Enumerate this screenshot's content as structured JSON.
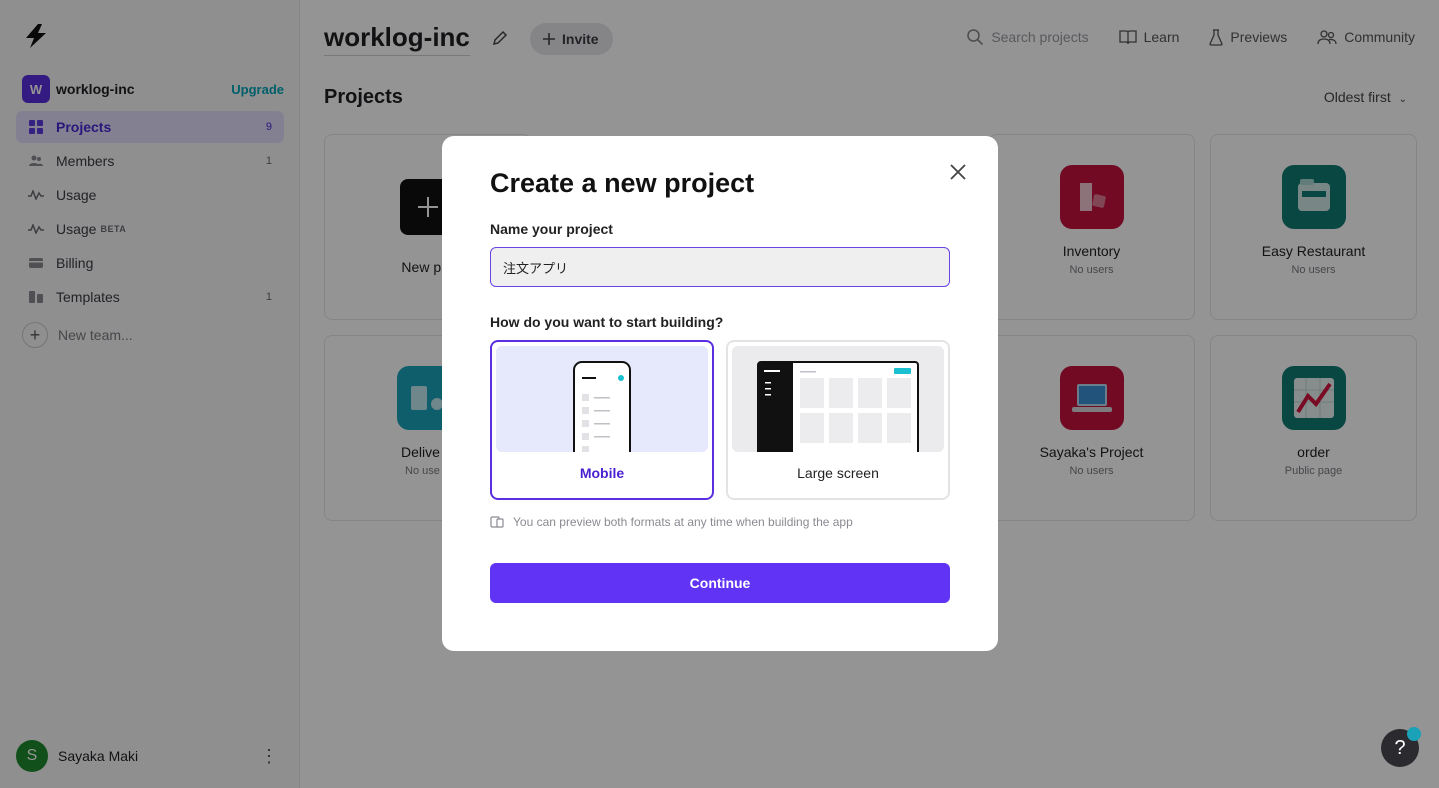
{
  "sidebar": {
    "team": {
      "initial": "W",
      "name": "worklog-inc",
      "upgrade": "Upgrade"
    },
    "items": [
      {
        "label": "Projects",
        "count": "9",
        "icon": "grid-icon",
        "active": true
      },
      {
        "label": "Members",
        "count": "1",
        "icon": "members-icon"
      },
      {
        "label": "Usage",
        "count": "",
        "icon": "pulse-icon"
      },
      {
        "label": "Usage",
        "badge": "BETA",
        "count": "",
        "icon": "pulse-icon"
      },
      {
        "label": "Billing",
        "count": "",
        "icon": "card-icon"
      },
      {
        "label": "Templates",
        "count": "1",
        "icon": "templates-icon"
      }
    ],
    "new_team": "New team...",
    "user": {
      "initial": "S",
      "name": "Sayaka Maki"
    }
  },
  "header": {
    "workspace_title": "worklog-inc",
    "invite": "Invite",
    "search_placeholder": "Search projects",
    "learn": "Learn",
    "previews": "Previews",
    "community": "Community"
  },
  "main": {
    "projects_heading": "Projects",
    "sort": "Oldest first",
    "cards": [
      {
        "title": "New pro",
        "sub": ""
      },
      {
        "title": "Inventory",
        "sub": "No users",
        "color": "#c4123f"
      },
      {
        "title": "Easy Restaurant",
        "sub": "No users",
        "color": "#0e7a72"
      },
      {
        "title": "Delive",
        "sub": "No use",
        "color": "#1aa3b8"
      },
      {
        "title": "Sayaka's Project",
        "sub": "No users",
        "color": "#c4123f"
      },
      {
        "title": "order",
        "sub": "Public page",
        "color": "#0e7a72"
      }
    ]
  },
  "modal": {
    "title": "Create a new project",
    "name_label": "Name your project",
    "name_value": "注文アプリ",
    "question": "How do you want to start building?",
    "options": [
      {
        "label": "Mobile",
        "selected": true
      },
      {
        "label": "Large screen",
        "selected": false
      }
    ],
    "hint": "You can preview both formats at any time when building the app",
    "continue": "Continue"
  },
  "colors": {
    "accent": "#6133f5",
    "teal": "#1aa3b8",
    "red": "#c4123f"
  },
  "help": "?"
}
